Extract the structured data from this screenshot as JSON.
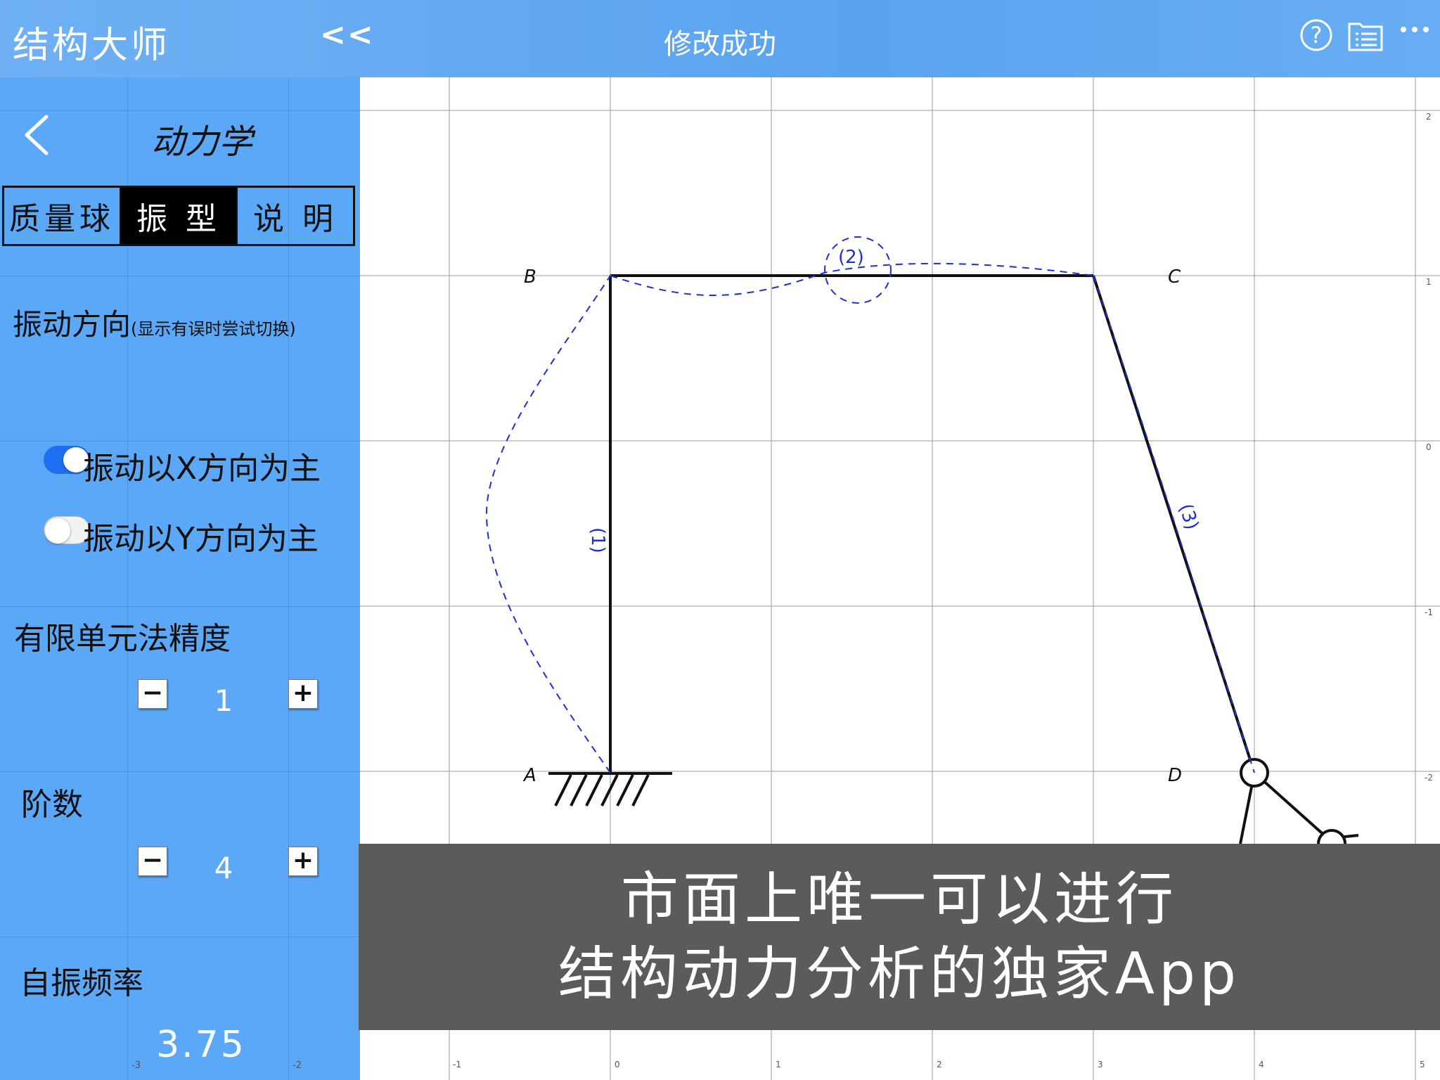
{
  "app": {
    "title": "结构大师",
    "collapse_label": "<<",
    "status": "修改成功"
  },
  "header_icons": [
    "help-icon",
    "list-icon",
    "more-icon"
  ],
  "panel": {
    "title": "动力学",
    "back_icon": "chevron-left-icon"
  },
  "tabs": [
    {
      "label": "质量球",
      "active": false
    },
    {
      "label": "振 型",
      "active": true
    },
    {
      "label": "说 明",
      "active": false
    }
  ],
  "vibration": {
    "label": "振动方向",
    "hint": "(显示有误时尝试切换)",
    "options": [
      {
        "label": "振动以X方向为主",
        "on": true
      },
      {
        "label": "振动以Y方向为主",
        "on": false
      }
    ]
  },
  "fem": {
    "label": "有限单元法精度",
    "value": "1",
    "minus": "−",
    "plus": "+"
  },
  "order": {
    "label": "阶数",
    "value": "4",
    "minus": "−",
    "plus": "+"
  },
  "frequency": {
    "label": "自振频率",
    "value": "3.75"
  },
  "canvas": {
    "x_ticks": [
      "-1",
      "0",
      "1",
      "2",
      "3",
      "4",
      "5"
    ],
    "sidebar_x_ticks": [
      "-3",
      "-2"
    ],
    "y_ticks": [
      "2",
      "1",
      "0",
      "-1",
      "-2"
    ],
    "nodes": [
      "A",
      "B",
      "C",
      "D"
    ],
    "members": [
      "(1)",
      "(2)",
      "(3)"
    ]
  },
  "colors": {
    "header": "#5aa4ee",
    "sidebar": "#5aa8f7",
    "mode_shape": "#1f2fd0",
    "banner": "#5b5b5b"
  },
  "banner": {
    "line1": "市面上唯一可以进行",
    "line2": "结构动力分析的独家App"
  }
}
